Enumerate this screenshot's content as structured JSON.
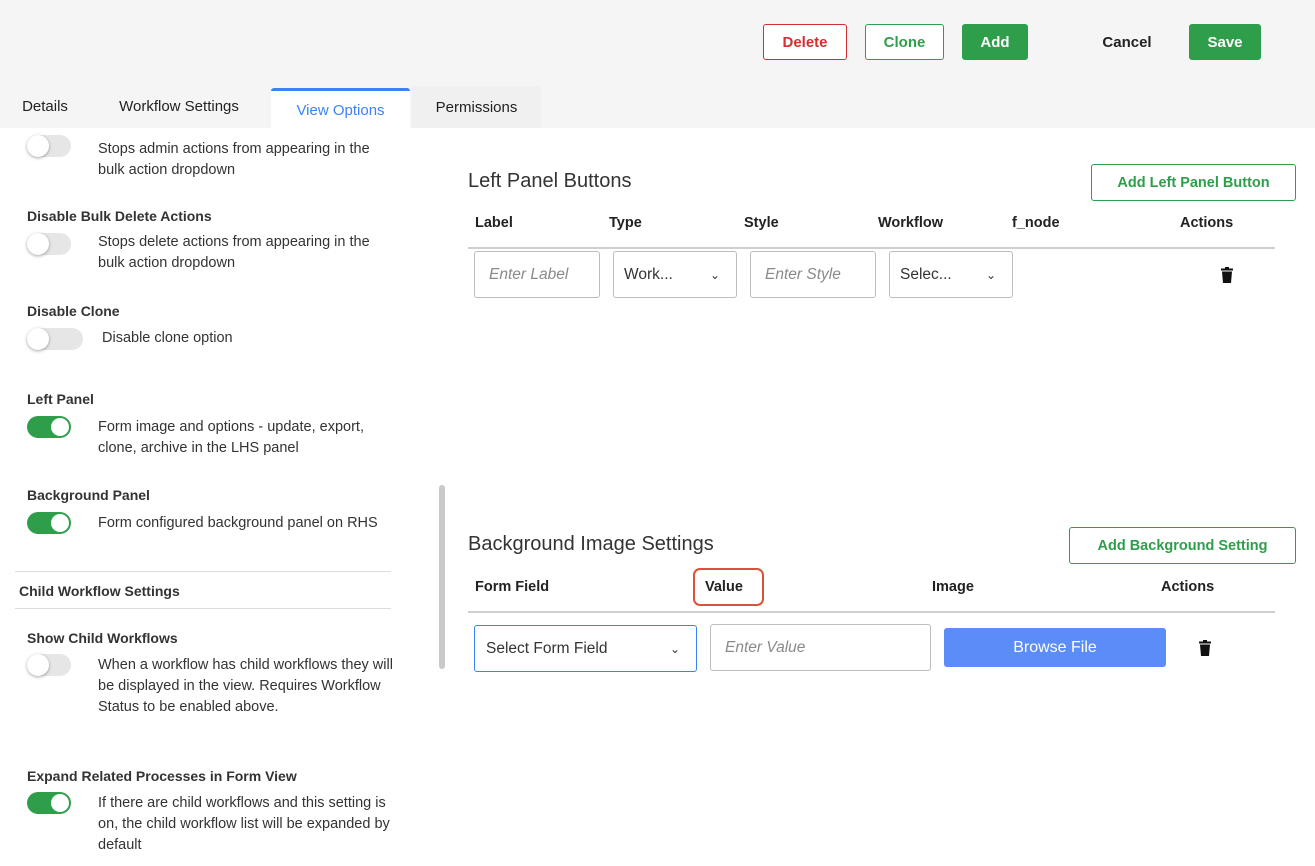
{
  "toolbar": {
    "delete_label": "Delete",
    "clone_label": "Clone",
    "add_label": "Add",
    "cancel_label": "Cancel",
    "save_label": "Save",
    "colors": {
      "danger": "#d32f2f",
      "success": "#2e9e4a",
      "primary": "#3b82f6"
    }
  },
  "tabs": [
    {
      "label": "Details",
      "active": false
    },
    {
      "label": "Workflow Settings",
      "active": false
    },
    {
      "label": "View Options",
      "active": true
    },
    {
      "label": "Permissions",
      "active": false
    }
  ],
  "settings": [
    {
      "title": "",
      "description": "Stops admin actions from appearing in the bulk action dropdown",
      "enabled": false
    },
    {
      "title": "Disable Bulk Delete Actions",
      "description": "Stops delete actions from appearing in the bulk action dropdown",
      "enabled": false
    },
    {
      "title": "Disable Clone",
      "description": "Disable clone option",
      "enabled": false
    },
    {
      "title": "Left Panel",
      "description": "Form image and options - update, export, clone, archive in the LHS panel",
      "enabled": true
    },
    {
      "title": "Background Panel",
      "description": "Form configured background panel on RHS",
      "enabled": true
    }
  ],
  "child_section": {
    "title": "Child Workflow Settings",
    "settings": [
      {
        "title": "Show Child Workflows",
        "description": "When a workflow has child workflows they will be displayed in the view. Requires Workflow Status to be enabled above.",
        "enabled": false
      },
      {
        "title": "Expand Related Processes in Form View",
        "description": "If there are child workflows and this setting is on, the child workflow list will be expanded by default",
        "enabled": true
      }
    ]
  },
  "left_panel_buttons": {
    "title": "Left Panel Buttons",
    "add_button_label": "Add Left Panel Button",
    "columns": [
      "Label",
      "Type",
      "Style",
      "Workflow",
      "f_node",
      "Actions"
    ],
    "row": {
      "label_placeholder": "Enter Label",
      "type_value": "Work...",
      "style_placeholder": "Enter Style",
      "workflow_value": "Selec..."
    }
  },
  "background_settings": {
    "title": "Background Image Settings",
    "add_button_label": "Add Background Setting",
    "columns": [
      "Form Field",
      "Value",
      "Image",
      "Actions"
    ],
    "row": {
      "form_field_value": "Select Form Field",
      "value_placeholder": "Enter Value",
      "browse_label": "Browse File"
    }
  },
  "icons": [
    "chevron-down-icon",
    "trash-icon"
  ]
}
